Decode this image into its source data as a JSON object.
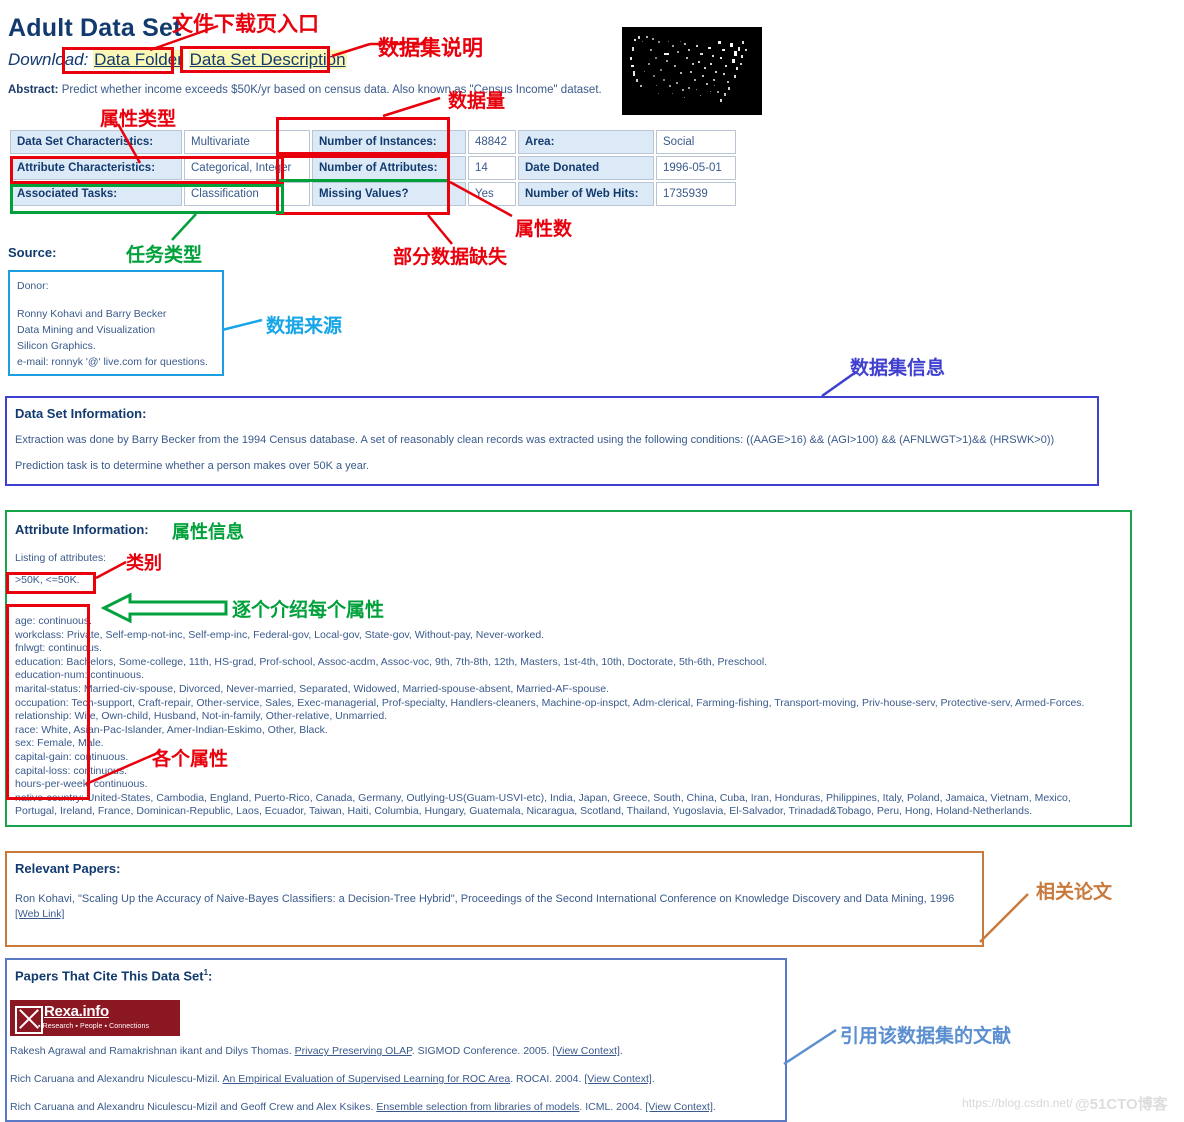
{
  "header": {
    "title": "Adult Data Set",
    "download_label": "Download:",
    "data_folder_link": "Data Folder",
    "data_set_description_link": "Data Set Description",
    "abstract_label": "Abstract:",
    "abstract_text": "Predict whether income exceeds $50K/yr based on census data. Also known as \"Census Income\" dataset."
  },
  "info_table": {
    "rows": [
      {
        "k1": "Data Set Characteristics:",
        "v1": "Multivariate",
        "k2": "Number of Instances:",
        "v2": "48842",
        "k3": "Area:",
        "v3": "Social"
      },
      {
        "k1": "Attribute Characteristics:",
        "v1": "Categorical, Integer",
        "k2": "Number of Attributes:",
        "v2": "14",
        "k3": "Date Donated",
        "v3": "1996-05-01"
      },
      {
        "k1": "Associated Tasks:",
        "v1": "Classification",
        "k2": "Missing Values?",
        "v2": "Yes",
        "k3": "Number of Web Hits:",
        "v3": "1735939"
      }
    ]
  },
  "source": {
    "label": "Source:",
    "lines": [
      "Donor:",
      "Ronny Kohavi and Barry Becker",
      "Data Mining and Visualization",
      "Silicon Graphics.",
      "e-mail: ronnyk '@' live.com for questions."
    ]
  },
  "data_set_information": {
    "heading": "Data Set Information:",
    "para1": "Extraction was done by Barry Becker from the 1994 Census database. A set of reasonably clean records was extracted using the following conditions: ((AAGE>16) && (AGI>100) && (AFNLWGT>1)&& (HRSWK>0))",
    "para2": "Prediction task is to determine whether a person makes over 50K a year."
  },
  "attribute_information": {
    "heading": "Attribute Information:",
    "listing_label": "Listing of attributes:",
    "classes": ">50K, <=50K.",
    "attributes": [
      "age: continuous.",
      "workclass: Private, Self-emp-not-inc, Self-emp-inc, Federal-gov, Local-gov, State-gov, Without-pay, Never-worked.",
      "fnlwgt: continuous.",
      "education: Bachelors, Some-college, 11th, HS-grad, Prof-school, Assoc-acdm, Assoc-voc, 9th, 7th-8th, 12th, Masters, 1st-4th, 10th, Doctorate, 5th-6th, Preschool.",
      "education-num: continuous.",
      "marital-status: Married-civ-spouse, Divorced, Never-married, Separated, Widowed, Married-spouse-absent, Married-AF-spouse.",
      "occupation: Tech-support, Craft-repair, Other-service, Sales, Exec-managerial, Prof-specialty, Handlers-cleaners, Machine-op-inspct, Adm-clerical, Farming-fishing, Transport-moving, Priv-house-serv, Protective-serv, Armed-Forces.",
      "relationship: Wife, Own-child, Husband, Not-in-family, Other-relative, Unmarried.",
      "race: White, Asian-Pac-Islander, Amer-Indian-Eskimo, Other, Black.",
      "sex: Female, Male.",
      "capital-gain: continuous.",
      "capital-loss: continuous.",
      "hours-per-week: continuous.",
      "native-country: United-States, Cambodia, England, Puerto-Rico, Canada, Germany, Outlying-US(Guam-USVI-etc), India, Japan, Greece, South, China, Cuba, Iran, Honduras, Philippines, Italy, Poland, Jamaica, Vietnam, Mexico,",
      "Portugal, Ireland, France, Dominican-Republic, Laos, Ecuador, Taiwan, Haiti, Columbia, Hungary, Guatemala, Nicaragua, Scotland, Thailand, Yugoslavia, El-Salvador, Trinadad&Tobago, Peru, Hong, Holand-Netherlands."
    ]
  },
  "relevant_papers": {
    "heading": "Relevant Papers:",
    "paper1": "Ron Kohavi, \"Scaling Up the Accuracy of Naive-Bayes Classifiers: a Decision-Tree Hybrid\", Proceedings of the Second International Conference on Knowledge Discovery and Data Mining, 1996",
    "web_link": "[Web Link]"
  },
  "citing_papers": {
    "heading": "Papers That Cite This Data Set",
    "heading_sup": "1",
    "heading_colon": ":",
    "rexa_logo": {
      "name": "Rexa.info",
      "tagline": "▪ Research ▪ People ▪ Connections"
    },
    "citations": [
      {
        "authors": "Rakesh Agrawal and Ramakrishnan ikant and Dilys Thomas.",
        "paper": "Privacy Preserving OLAP",
        "venue": ". SIGMOD Conference. 2005. ",
        "context": "[View Context]",
        "end": "."
      },
      {
        "authors": "Rich Caruana and Alexandru Niculescu-Mizil.",
        "paper": "An Empirical Evaluation of Supervised Learning for ROC Area",
        "venue": ". ROCAI. 2004. ",
        "context": "[View Context]",
        "end": "."
      },
      {
        "authors": "Rich Caruana and Alexandru Niculescu-Mizil and Geoff Crew and Alex Ksikes.",
        "paper": "Ensemble selection from libraries of models",
        "venue": ". ICML. 2004. ",
        "context": "[View Context]",
        "end": "."
      }
    ]
  },
  "annotations": [
    {
      "id": "file-download-entry",
      "text": "文件下载页入口",
      "color": "#e8000d"
    },
    {
      "id": "dataset-description",
      "text": "数据集说明",
      "color": "#e8000d"
    },
    {
      "id": "attribute-type",
      "text": "属性类型",
      "color": "#e8000d"
    },
    {
      "id": "data-volume",
      "text": "数据量",
      "color": "#e8000d"
    },
    {
      "id": "attribute-count",
      "text": "属性数",
      "color": "#e8000d"
    },
    {
      "id": "missing-data",
      "text": "部分数据缺失",
      "color": "#e8000d"
    },
    {
      "id": "task-type",
      "text": "任务类型",
      "color": "#00a13a"
    },
    {
      "id": "data-source",
      "text": "数据来源",
      "color": "#16a6e8"
    },
    {
      "id": "dataset-info",
      "text": "数据集信息",
      "color": "#3f3fd0"
    },
    {
      "id": "attribute-info",
      "text": "属性信息",
      "color": "#00a13a"
    },
    {
      "id": "class-label",
      "text": "类别",
      "color": "#e8000d"
    },
    {
      "id": "each-attribute-intro",
      "text": "逐个介绍每个属性",
      "color": "#00a13a"
    },
    {
      "id": "individual-attributes",
      "text": "各个属性",
      "color": "#e8000d"
    },
    {
      "id": "relevant-papers",
      "text": "相关论文",
      "color": "#c8793c"
    },
    {
      "id": "citing-literature",
      "text": "引用该数据集的文献",
      "color": "#5b8fd0"
    }
  ],
  "watermark": {
    "url": "https://blog.csdn.net/",
    "brand": "@51CTO博客"
  }
}
